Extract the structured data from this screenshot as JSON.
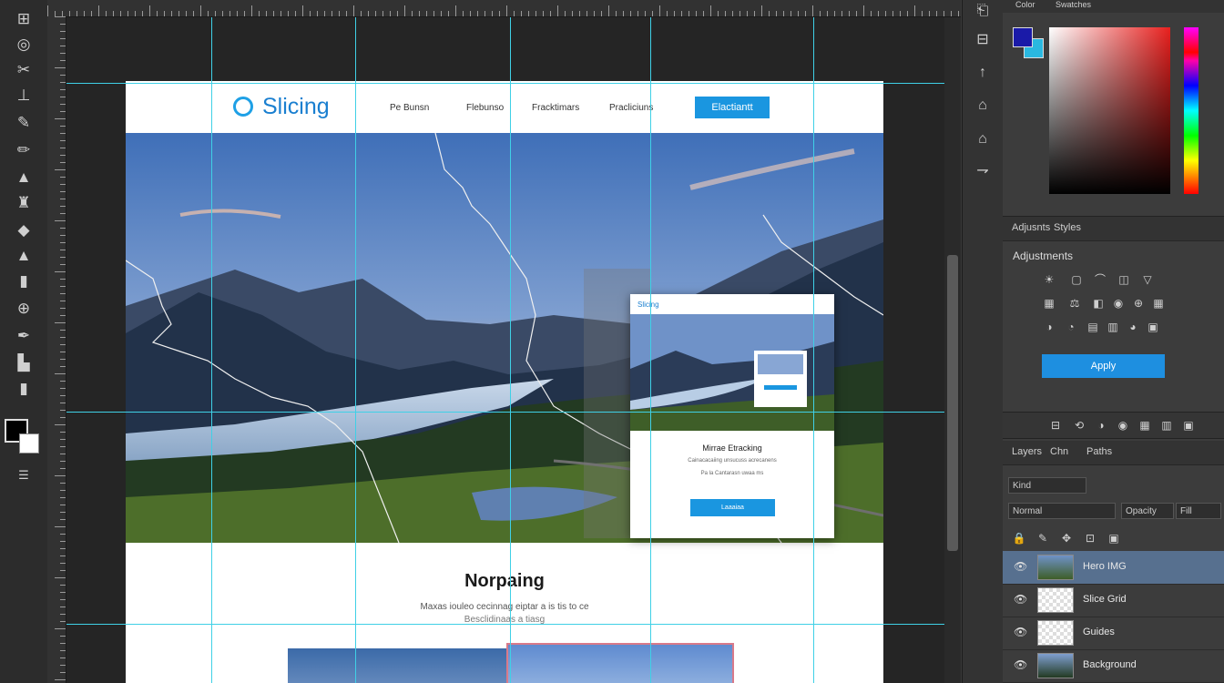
{
  "toolbar": {
    "tools": [
      "artboard-tool-icon",
      "lasso-icon",
      "crop-icon",
      "slice-icon",
      "healing-icon",
      "brush-icon",
      "stamp-icon",
      "history-brush-icon",
      "eraser-icon",
      "gradient-icon",
      "blur-icon",
      "dodge-icon",
      "pen-icon",
      "type-icon",
      "path-select-icon",
      "hand-icon"
    ],
    "foreground_color": "#000000",
    "background_color": "#ffffff"
  },
  "site": {
    "logo_text": "Slicing",
    "nav": [
      "Pe Bunsn",
      "Flebunso",
      "Fracktimars",
      "Pracliciuns"
    ],
    "cta": "Elactiantt",
    "section_title": "Norpaing",
    "section_text1": "Maxas iouleo cecinnag eiptar a is tis to ce",
    "section_text2": "Besclidinaas a tiasg"
  },
  "mock": {
    "logo_text": "Slicing",
    "title": "Mirrae Etracking",
    "text1": "Cainacacaiing unsucuss acrecanens",
    "text2": "Pa la Cantarasn uwaa ms",
    "button": "Laaaiaa"
  },
  "right_panel": {
    "color_tabs": [
      "Color",
      "Swatches"
    ],
    "fg_color": "#1a1aa8",
    "bg_color": "#2ab8e0",
    "adj_tabs": [
      "Adjusnts",
      "Styles"
    ],
    "adj_title": "Adjustments",
    "adj_button": "Apply",
    "layer_tabs": [
      "Layers",
      "Chn",
      "Paths"
    ],
    "kind_label": "Kind",
    "blend_label": "Normal",
    "opacity_label": "Opacity",
    "fill_label": "Fill",
    "layers": [
      {
        "name": "Hero IMG",
        "selected": true,
        "thumb": "photo"
      },
      {
        "name": "Slice Grid",
        "selected": false,
        "thumb": "transparent"
      },
      {
        "name": "Guides",
        "selected": false,
        "thumb": "transparent"
      },
      {
        "name": "Background",
        "selected": false,
        "thumb": "photo"
      }
    ]
  }
}
